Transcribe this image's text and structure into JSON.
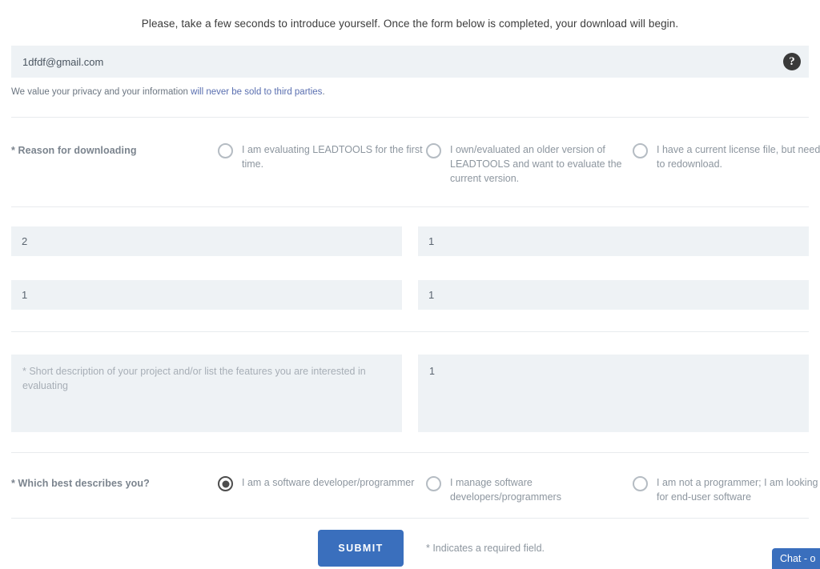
{
  "intro": {
    "message": "Please, take a few seconds to introduce yourself. Once the form below is completed, your download will begin."
  },
  "email": {
    "value": "1dfdf@gmail.com",
    "placeholder": "Email",
    "help_icon": "question-mark-icon",
    "help_glyph": "?"
  },
  "privacy": {
    "prefix": "We value your privacy and your information ",
    "link": "will never be sold to third parties",
    "suffix": ".",
    "link_color": "#5a6fb0"
  },
  "reason": {
    "label": "* Reason for downloading",
    "options": [
      {
        "text": "I am evaluating LEADTOOLS for the first time.",
        "checked": false
      },
      {
        "text": "I own/evaluated an older version of LEADTOOLS and want to evaluate the current version.",
        "checked": false
      },
      {
        "text": "I have a current license file, but need to redownload.",
        "checked": false
      }
    ]
  },
  "fields": {
    "row1": [
      {
        "value": "2",
        "placeholder": ""
      },
      {
        "value": "1",
        "placeholder": ""
      }
    ],
    "row2": [
      {
        "value": "1",
        "placeholder": ""
      },
      {
        "value": "1",
        "placeholder": ""
      }
    ]
  },
  "textareas": [
    {
      "value": "",
      "placeholder": "* Short description of your project and/or list the features you are interested in evaluating",
      "is_placeholder": true
    },
    {
      "value": "1",
      "placeholder": "",
      "is_placeholder": false
    }
  ],
  "describes": {
    "label": "* Which best describes you?",
    "options": [
      {
        "text": "I am a software developer/programmer",
        "checked": true
      },
      {
        "text": "I manage software developers/programmers",
        "checked": false
      },
      {
        "text": "I am not a programmer; I am looking for end-user software",
        "checked": false
      }
    ]
  },
  "submit": {
    "label": "SUBMIT",
    "color": "#3a6fbd",
    "required_note": "* Indicates a required field."
  },
  "chat": {
    "label": "Chat - o",
    "color": "#3a6fbd"
  }
}
